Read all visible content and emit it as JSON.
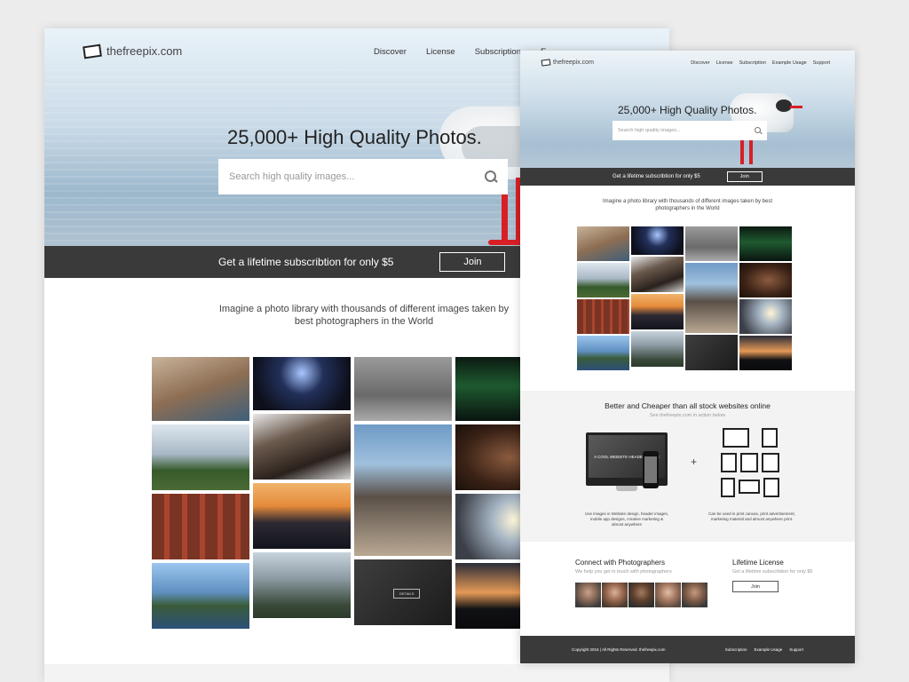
{
  "large_page": {
    "logo_text": "thefreepix.com",
    "nav": [
      "Discover",
      "License",
      "Subscription",
      "E"
    ],
    "headline": "25,000+ High Quality Photos.",
    "search_placeholder": "Search high quality images...",
    "promo_text": "Get a lifetime subscribtion for only $5",
    "join_label": "Join",
    "intro_text": "Imagine a photo library with thousands of different images taken by best photographers in the World",
    "details_label": "DETAILS"
  },
  "small_page": {
    "logo_text": "thefreepix.com",
    "nav": [
      "Discover",
      "License",
      "Subscription",
      "Example Usage",
      "Support"
    ],
    "headline": "25,000+ High Quality Photos.",
    "search_placeholder": "Search high quality images...",
    "promo_text": "Get a lifetime subscribtion for only $5",
    "join_label": "Join",
    "intro_text": "Imagine a photo library with thousands of different images taken by best photographers in the World",
    "better_title": "Better and Cheaper than all stock websites online",
    "better_sub": "See thefreepix.com in action below",
    "monitor_text": "A COOL WEBSITE HEADER IMAGE",
    "plus": "+",
    "caption_left": "Use images in Website design, header images, mobile app designs, creative marketing & almost anywhere",
    "caption_right": "Can be used in print canvas, print advertisement, marketing material and almost anywhere print.",
    "connect_title": "Connect with Photographers",
    "connect_sub": "We help you get in touch with photographers",
    "license_title": "Lifetime License",
    "license_sub": "Get a lifetime subscribtion for only $5",
    "license_join": "Join",
    "footer_copy": "Copyright 2016  |  All Rights Reserved. thefreepix.com",
    "footer_links": [
      "Subscription",
      "Example Usage",
      "Support"
    ]
  },
  "colors": {
    "accent_red": "#d81f26",
    "dark_bar": "#3a3a3a",
    "light_section": "#f3f3f3"
  }
}
